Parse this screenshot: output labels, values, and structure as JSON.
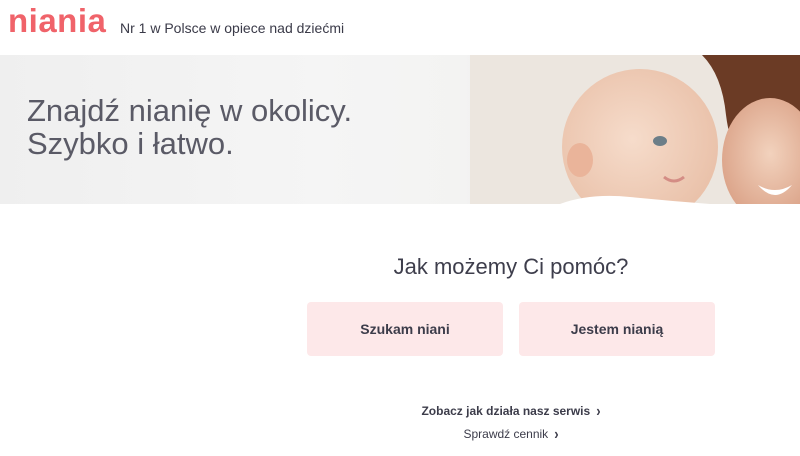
{
  "header": {
    "logo_text": "niania",
    "tagline": "Nr 1 w Polsce w opiece nad dziećmi"
  },
  "hero": {
    "line1": "Znajdź nianię w okolicy.",
    "line2": "Szybko i łatwo."
  },
  "main": {
    "question": "Jak możemy Ci pomóc?",
    "buttons": {
      "seeking": "Szukam niani",
      "nanny": "Jestem nianią"
    },
    "links": {
      "how_it_works": "Zobacz jak działa nasz serwis",
      "pricing": "Sprawdź cennik"
    }
  },
  "icons": {
    "chevron": "chevron-right-icon"
  },
  "colors": {
    "brand": "#f0636a",
    "button_bg": "#fde8e9",
    "text": "#3c3c4a"
  }
}
